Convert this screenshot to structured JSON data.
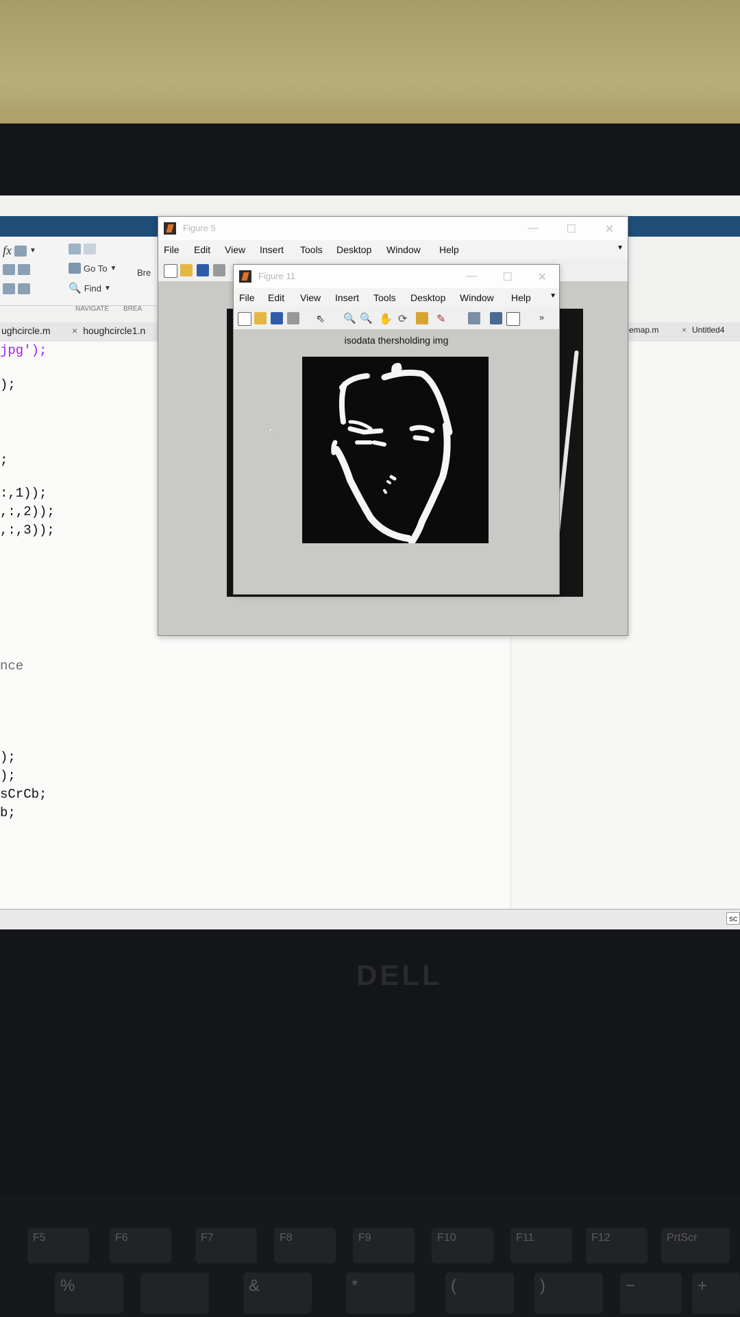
{
  "desktop": {
    "ribbon": {
      "fx_label": "fx",
      "goto_label": "Go To",
      "find_label": "Find",
      "bre_label": "Bre",
      "navigate_label": "NAVIGATE",
      "brea_label": "BREA"
    },
    "tabs": {
      "left1": "ughcircle.m",
      "left2": "houghcircle1.n",
      "right1": "emap.m",
      "right2": "Untitled4"
    },
    "code_lines": [
      "jpg');",
      ");",
      ";",
      ":,1));",
      ",:,2));",
      ",:,3));",
      "nce",
      ");",
      ");",
      "sCrCb;",
      "b;"
    ],
    "status_right": "sc"
  },
  "figure5": {
    "title": "Figure 5",
    "menus": [
      "File",
      "Edit",
      "View",
      "Insert",
      "Tools",
      "Desktop",
      "Window",
      "Help"
    ]
  },
  "figure11": {
    "title": "Figure 11",
    "menus": [
      "File",
      "Edit",
      "View",
      "Insert",
      "Tools",
      "Desktop",
      "Window",
      "Help"
    ],
    "axes_title": "isodata thersholding img"
  },
  "laptop": {
    "brand": "DELL",
    "keys_row1": [
      "F5",
      "F6",
      "F7",
      "F8",
      "F9",
      "F10",
      "F11",
      "F12",
      "PrtScr"
    ],
    "keys_row2": [
      "%",
      "",
      "&",
      "*",
      "(",
      ")",
      "−",
      "+"
    ]
  },
  "colors": {
    "matlab_ribbon": "#1f4e79",
    "figure_bg": "#c9cac6",
    "image_bg": "#0b0b0b",
    "edge_white": "#f5f5f5"
  }
}
